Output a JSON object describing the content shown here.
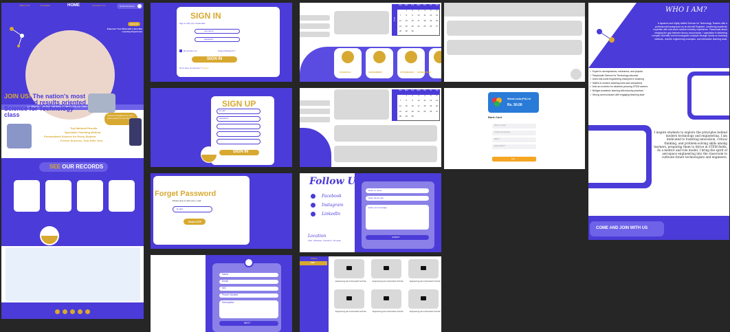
{
  "home": {
    "nav": [
      "ABOUT US",
      "COURSES",
      "HOME",
      "CONTACT US"
    ],
    "user": "Hiruni Fernando",
    "join_btn": "JOIN US",
    "hero_tag": "Empower Your Mind with a Sensible Learning Experience",
    "banner": "Looking for more than just theory? Here's why our class stands out!",
    "join_head_1": "JOIN US!",
    "join_head_2": " The nation's most trusted and results oriented Science for Technology class",
    "callout": "Science simplified & to Tech - read a great. It's our Standard.",
    "features": [
      "Top National Results",
      "Specialist Teaching Method",
      "Personalized Science for Every Student",
      "Proven Success, Year After Year"
    ],
    "records_title_1": "SEE ",
    "records_title_2": "OUR RECORDS"
  },
  "signin": {
    "title": "SIGN IN",
    "subtitle": "Sign in with your credentials",
    "username": "username",
    "password": "password",
    "remember": "Remember me",
    "forgot": "Forgot Password ?",
    "button": "SIGN IN",
    "signup_prompt": "Don't have an account ? ",
    "signup_link": "Signup"
  },
  "signup": {
    "title": "SIGN UP",
    "fields": [
      "E-mail",
      "password",
      "",
      "",
      ""
    ],
    "button": "SIGN IN"
  },
  "forgot": {
    "title": "Forget Password",
    "subtitle": "Please give us with your e-mail",
    "email": "E-mail",
    "button": "Send OTP"
  },
  "register": {
    "fields": [
      "Name",
      "Email",
      "NIC",
      "Phone Number",
      "Description"
    ],
    "button": "NEXT"
  },
  "calendar": {
    "days": [
      "Sun",
      "Mon",
      "Tue",
      "Wed",
      "Thu",
      "Fri",
      "Sat"
    ],
    "month": "June",
    "rows": [
      [
        "",
        "1",
        "2",
        "3",
        "4",
        "5",
        "6"
      ],
      [
        "7",
        "8",
        "9",
        "10",
        "11",
        "12",
        "13"
      ],
      [
        "14",
        "15",
        "16",
        "17",
        "18",
        "19",
        "20"
      ],
      [
        "21",
        "22",
        "23",
        "24",
        "25",
        "26",
        "27"
      ],
      [
        "28",
        "29",
        "30",
        "",
        "",
        "",
        ""
      ]
    ]
  },
  "modules": {
    "labels": [
      "SCHEDULE",
      "ASSIGNMENT",
      "ATTENDANCE",
      "ASSIGNMENT"
    ]
  },
  "contact": {
    "title": "Follow Us",
    "socials": [
      "Facebook",
      "Instagram",
      "LinkedIn"
    ],
    "location_title": "Location",
    "location": "Thiris , Moratuwa , Colombo 5 , Sri Lanka",
    "inputs": [
      "Enter Ur name",
      "Enter the E-mail",
      "Enter your message"
    ],
    "button": "SUBMIT"
  },
  "videos": {
    "tab": "Videos",
    "sub": "PDF",
    "caption": "Engineering part to Recorded YouTube"
  },
  "payment": {
    "brand": "Ithema Lanka (Pvt) Ltd",
    "amount": "Rs. 50.00",
    "title": "Bank Card",
    "fields": [
      "Name on Card",
      "Credit Card Number",
      "MM/YY",
      "Expiry MM/YY"
    ],
    "pay": "Pay"
  },
  "about": {
    "title": "WHO I AM?",
    "intro": "A dynamic and highly skilled Science for Technology Teacher with a professional background as an Aircraft Engineer, combining academic expertise with real-world aviation industry experience. Passionate about bridging the gap between theory and practice, I specialize in delivering complex scientific and technological concepts through hands-on teaching methods, real-life engineering examples, and interactive learning tools.",
    "points": [
      "Expert in aerodynamics, mechanics, and physics",
      "Passionate Science for Technology educator",
      "Uses real-world engineering examples in teaching",
      "Skilled in modern teaching tools and simulations",
      "Acts as a mentor for students pursuing STEM careers",
      "Bridges academic learning with industry practices",
      "Strong communicator with engaging teaching style"
    ],
    "quote": "I inspire students to explore the principles behind modern technology and engineering. I am dedicated to fostering innovation, critical thinking, and problem-solving skills among learners, preparing them to thrive in STEM fields. As a mentor and role model, I bring the spirit of aerospace engineering into the classroom to cultivate future technologists and engineers.",
    "cta": "COME AND JOIN WITH US"
  }
}
